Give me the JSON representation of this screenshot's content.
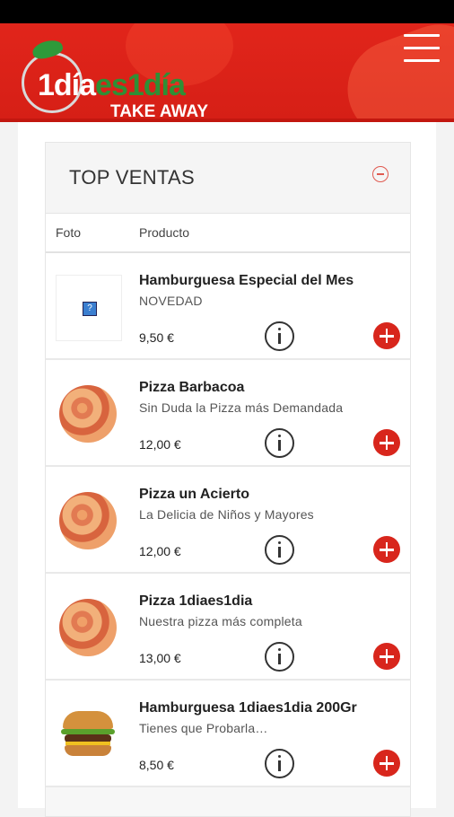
{
  "header": {
    "logo": {
      "brand_part1": "1día",
      "brand_part2": "es1",
      "brand_part3": "día",
      "tagline": "TAKE AWAY"
    }
  },
  "panel": {
    "title": "TOP VENTAS"
  },
  "columns": {
    "foto": "Foto",
    "producto": "Producto"
  },
  "products": [
    {
      "name": "Hamburguesa Especial del Mes",
      "desc": "NOVEDAD",
      "price": "9,50 €",
      "image": "placeholder"
    },
    {
      "name": "Pizza Barbacoa",
      "desc": "Sin Duda la Pizza más Demandada",
      "price": "12,00 €",
      "image": "pizza"
    },
    {
      "name": "Pizza un Acierto",
      "desc": "La Delicia de Niños y Mayores",
      "price": "12,00 €",
      "image": "pizza"
    },
    {
      "name": "Pizza 1diaes1dia",
      "desc": "Nuestra pizza más completa",
      "price": "13,00 €",
      "image": "pizza"
    },
    {
      "name": "Hamburguesa 1diaes1dia 200Gr",
      "desc": "Tienes que Probarla…",
      "price": "8,50 €",
      "image": "burger"
    }
  ],
  "icons": {
    "menu": "hamburger-menu-icon",
    "collapse": "minus-circle-icon",
    "info": "info-icon",
    "add": "plus-circle-icon"
  },
  "colors": {
    "brand_red": "#e1251b",
    "brand_green": "#2f8f35",
    "add_red": "#d8261c"
  }
}
